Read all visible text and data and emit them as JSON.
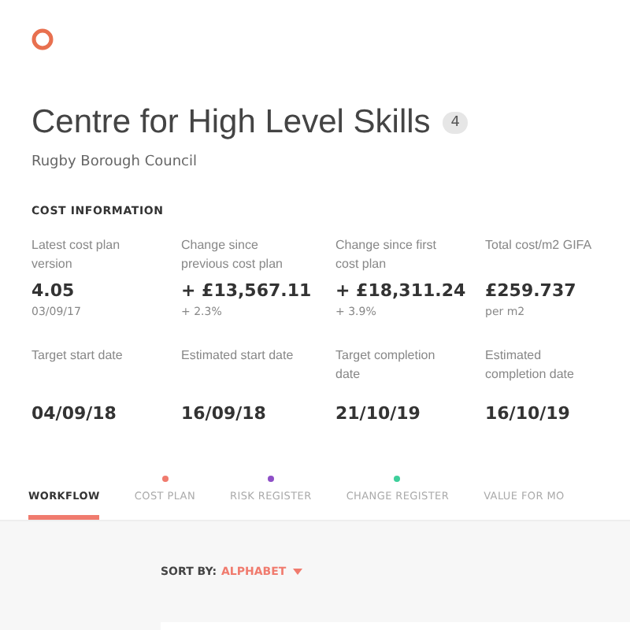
{
  "header": {
    "title": "Centre for High Level Skills",
    "count": "4",
    "subtitle": "Rugby Borough Council"
  },
  "cost_information": {
    "heading": "COST INFORMATION",
    "items": [
      {
        "label": "Latest cost plan version",
        "value": "4.05",
        "sub": "03/09/17"
      },
      {
        "label": "Change since previous cost plan",
        "value": "+ £13,567.11",
        "sub": "+ 2.3%"
      },
      {
        "label": "Change since first cost plan",
        "value": "+ £18,311.24",
        "sub": "+ 3.9%"
      },
      {
        "label": "Total cost/m2 GIFA",
        "value": "£259.737",
        "sub": "per m2"
      },
      {
        "label": "Target start date",
        "value": "04/09/18"
      },
      {
        "label": "Estimated start date",
        "value": "16/09/18"
      },
      {
        "label": "Target completion date",
        "value": "21/10/19"
      },
      {
        "label": "Estimated completion date",
        "value": "16/10/19"
      }
    ]
  },
  "tabs": [
    {
      "label": "WORKFLOW",
      "selected": true
    },
    {
      "label": "COST PLAN",
      "selected": false,
      "color": "#f07b6e"
    },
    {
      "label": "RISK REGISTER",
      "selected": false,
      "color": "#8e4fc7"
    },
    {
      "label": "CHANGE REGISTER",
      "selected": false,
      "color": "#3ecf9b"
    },
    {
      "label": "VALUE FOR MO",
      "selected": false
    }
  ],
  "sort": {
    "label": "SORT BY:",
    "value": "ALPHABET"
  }
}
